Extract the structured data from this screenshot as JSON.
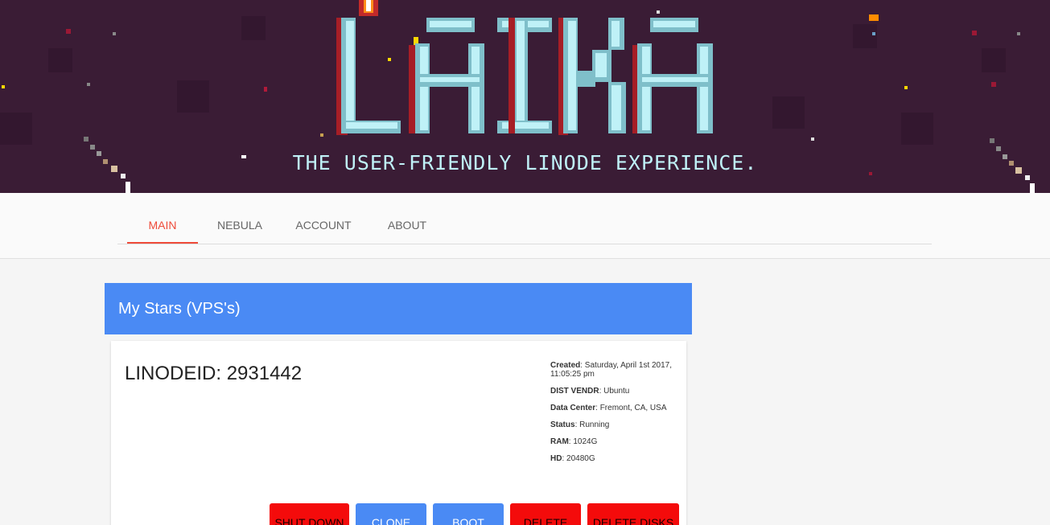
{
  "banner": {
    "logo": "LAIKA",
    "tagline": "THE USER-FRIENDLY LINODE EXPERIENCE."
  },
  "nav": {
    "tabs": [
      {
        "label": "MAIN",
        "active": true
      },
      {
        "label": "NEBULA",
        "active": false
      },
      {
        "label": "ACCOUNT",
        "active": false
      },
      {
        "label": "ABOUT",
        "active": false
      }
    ]
  },
  "section": {
    "title": "My Stars (VPS's)"
  },
  "vps": {
    "linode_id": "LINODEID: 2931442",
    "details": [
      {
        "label": "Created",
        "value": ": Saturday, April 1st 2017, 11:05:25 pm"
      },
      {
        "label": "DIST VENDR",
        "value": ": Ubuntu"
      },
      {
        "label": "Data Center",
        "value": ": Fremont, CA, USA"
      },
      {
        "label": "Status",
        "value": ": Running"
      },
      {
        "label": "RAM",
        "value": ": 1024G"
      },
      {
        "label": "HD",
        "value": ": 20480G"
      }
    ],
    "actions": {
      "shutdown": "SHUT DOWN",
      "clone": "CLONE",
      "boot": "BOOT",
      "delete": "DELETE",
      "delete_disks": "DELETE DISKS"
    }
  },
  "colors": {
    "banner_bg": "#3a1c35",
    "accent": "#ee4b3a",
    "primary": "#4a8af4",
    "danger": "#f40b0b",
    "logo_fill": "#bff1f7"
  }
}
